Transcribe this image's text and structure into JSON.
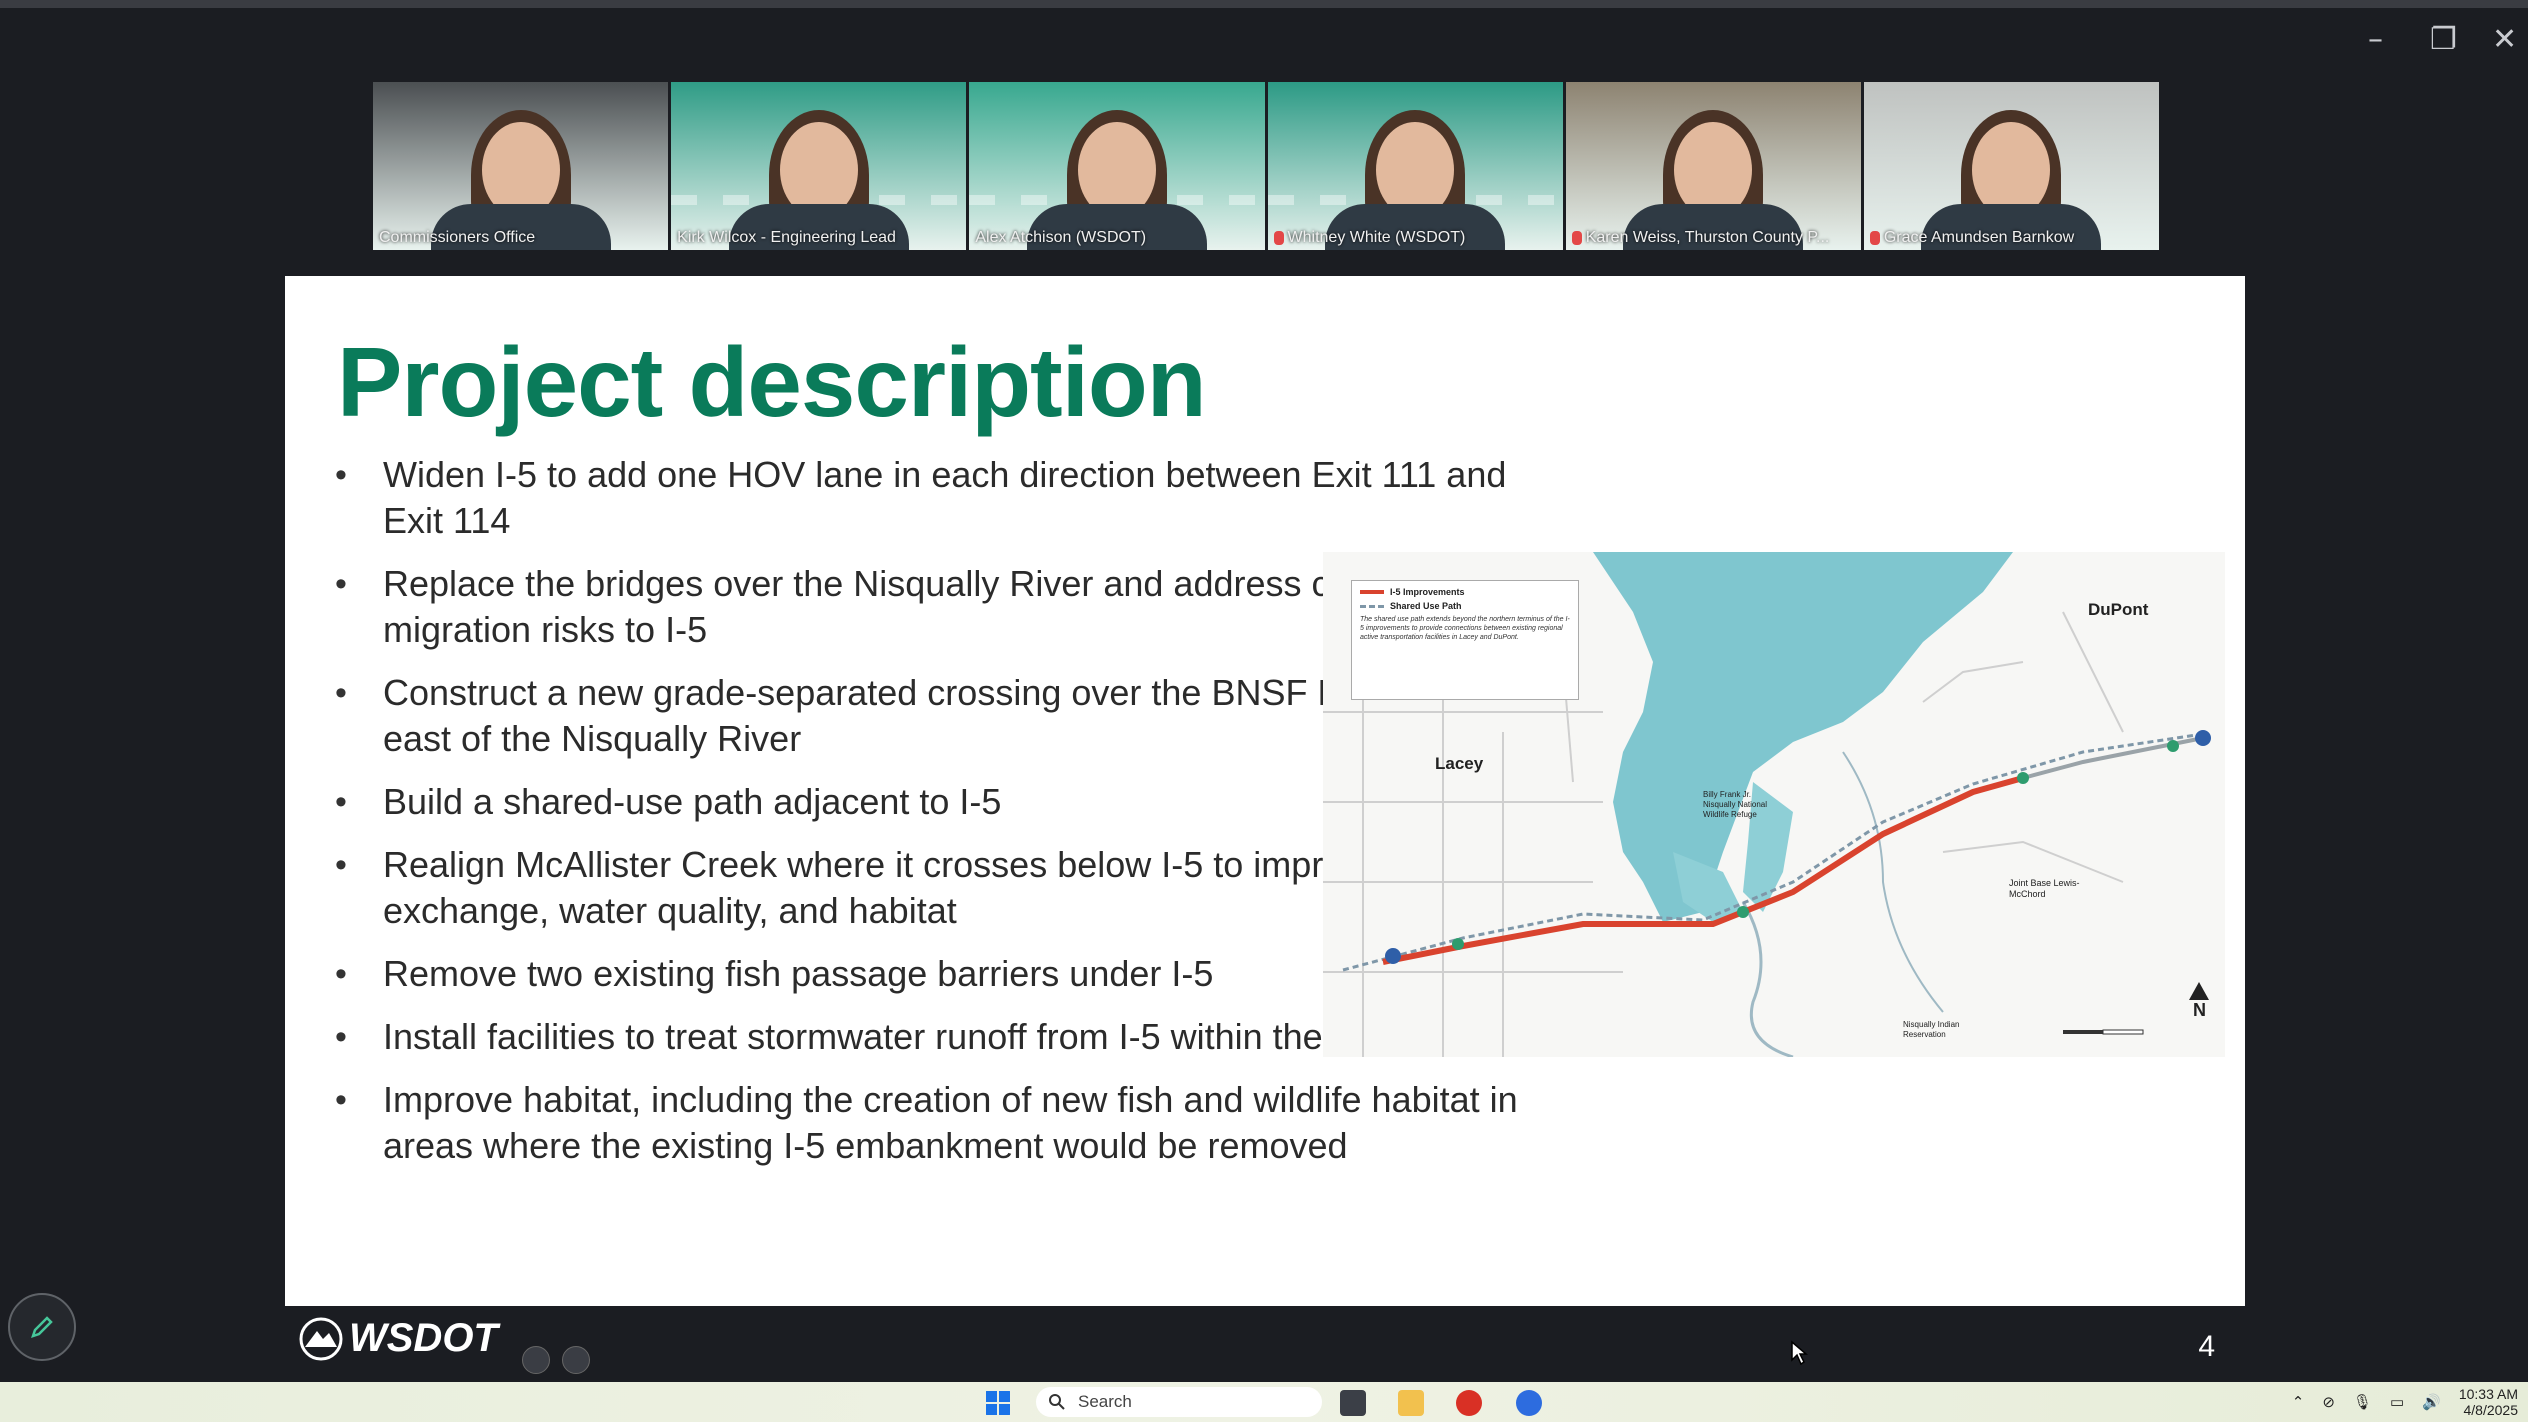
{
  "window": {
    "minimize_glyph": "–",
    "restore_glyph": "❐",
    "close_glyph": "✕"
  },
  "participants": [
    {
      "name": "Commissioners Office",
      "muted": false,
      "active": false,
      "bg": "#4b4f52"
    },
    {
      "name": "Kirk Wilcox - Engineering Lead",
      "muted": false,
      "active": false,
      "bg": "#2f9c86"
    },
    {
      "name": "Alex Atchison (WSDOT)",
      "muted": false,
      "active": true,
      "bg": "#38a88f"
    },
    {
      "name": "Whitney White (WSDOT)",
      "muted": true,
      "active": false,
      "bg": "#2c9a85"
    },
    {
      "name": "Karen Weiss, Thurston County P...",
      "muted": true,
      "active": false,
      "bg": "#8d8371"
    },
    {
      "name": "Grace Amundsen Barnkow",
      "muted": true,
      "active": false,
      "bg": "#bfc2c0"
    }
  ],
  "slide": {
    "title": "Project description",
    "bullets": [
      "Widen I-5 to add one HOV lane in each direction between Exit 111 and Exit 114",
      "Replace the bridges over the Nisqually River and address channel migration risks to I-5",
      "Construct a new grade-separated crossing over the BNSF Railway tracks east of the Nisqually River",
      "Build a shared-use path adjacent to I-5",
      "Realign McAllister Creek where it crosses below I-5 to improve tidal exchange, water quality, and habitat",
      "Remove two existing fish passage barriers under I-5",
      "Install facilities to treat stormwater runoff from I-5 within the study area",
      "Improve habitat, including the creation of new fish and wildlife habitat in areas where the existing I-5 embankment would be removed"
    ],
    "map": {
      "legend_improvements": "I-5 Improvements",
      "legend_path": "Shared Use Path",
      "legend_note": "The shared use path extends beyond the northern terminus of the I-5 improvements to provide connections between existing regional active transportation facilities in Lacey and DuPont.",
      "label_lacey": "Lacey",
      "label_dupont": "DuPont",
      "label_refuge": "Billy Frank Jr. Nisqually National Wildlife Refuge",
      "label_jblm": "Joint Base Lewis-McChord",
      "label_reservation": "Nisqually Indian Reservation",
      "north": "N",
      "colors": {
        "water": "#7fc6cf",
        "route": "#d9432e",
        "land": "#f7f7f5"
      }
    }
  },
  "footer": {
    "logo": "WSDOT",
    "page": "4"
  },
  "taskbar": {
    "search_placeholder": "Search",
    "time": "10:33 AM",
    "date": "4/8/2025"
  }
}
